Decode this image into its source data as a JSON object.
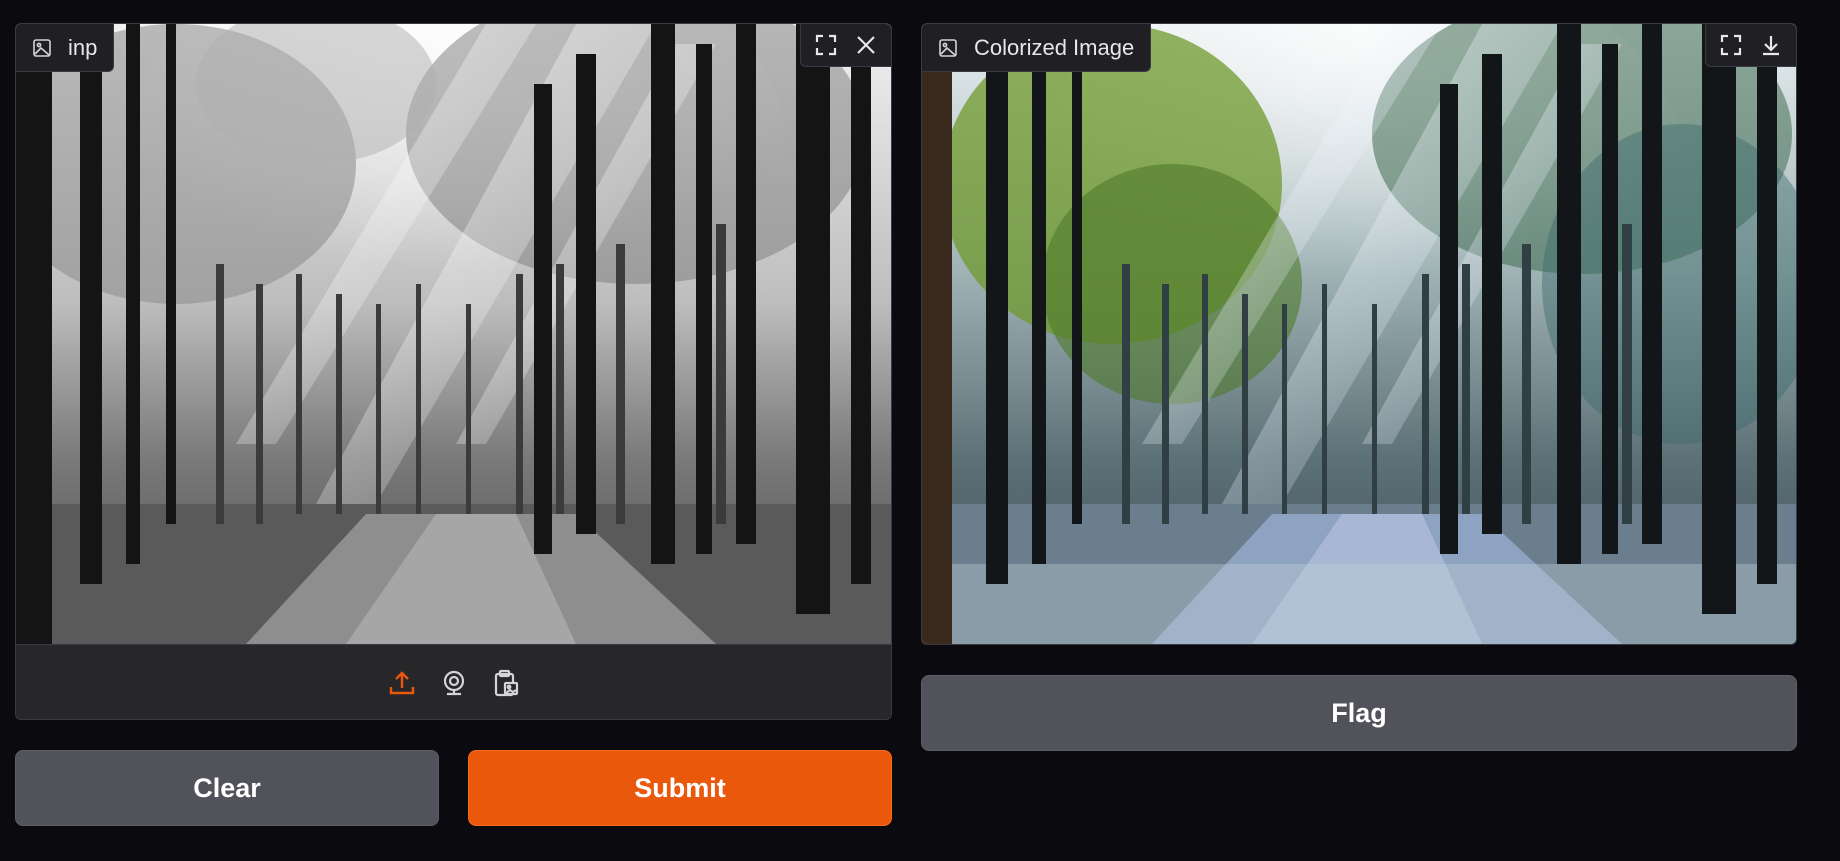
{
  "input": {
    "label": "inp",
    "icons": [
      "image-icon",
      "fullscreen-icon",
      "close-icon",
      "upload-icon",
      "webcam-icon",
      "clipboard-icon"
    ]
  },
  "output": {
    "label": "Colorized Image",
    "icons": [
      "image-icon",
      "fullscreen-icon",
      "download-icon"
    ]
  },
  "buttons": {
    "clear": "Clear",
    "submit": "Submit",
    "flag": "Flag"
  },
  "colors": {
    "accent": "#ea580c",
    "secondary_button": "#52525b",
    "background": "#0b0b0f",
    "panel": "#27272a"
  }
}
